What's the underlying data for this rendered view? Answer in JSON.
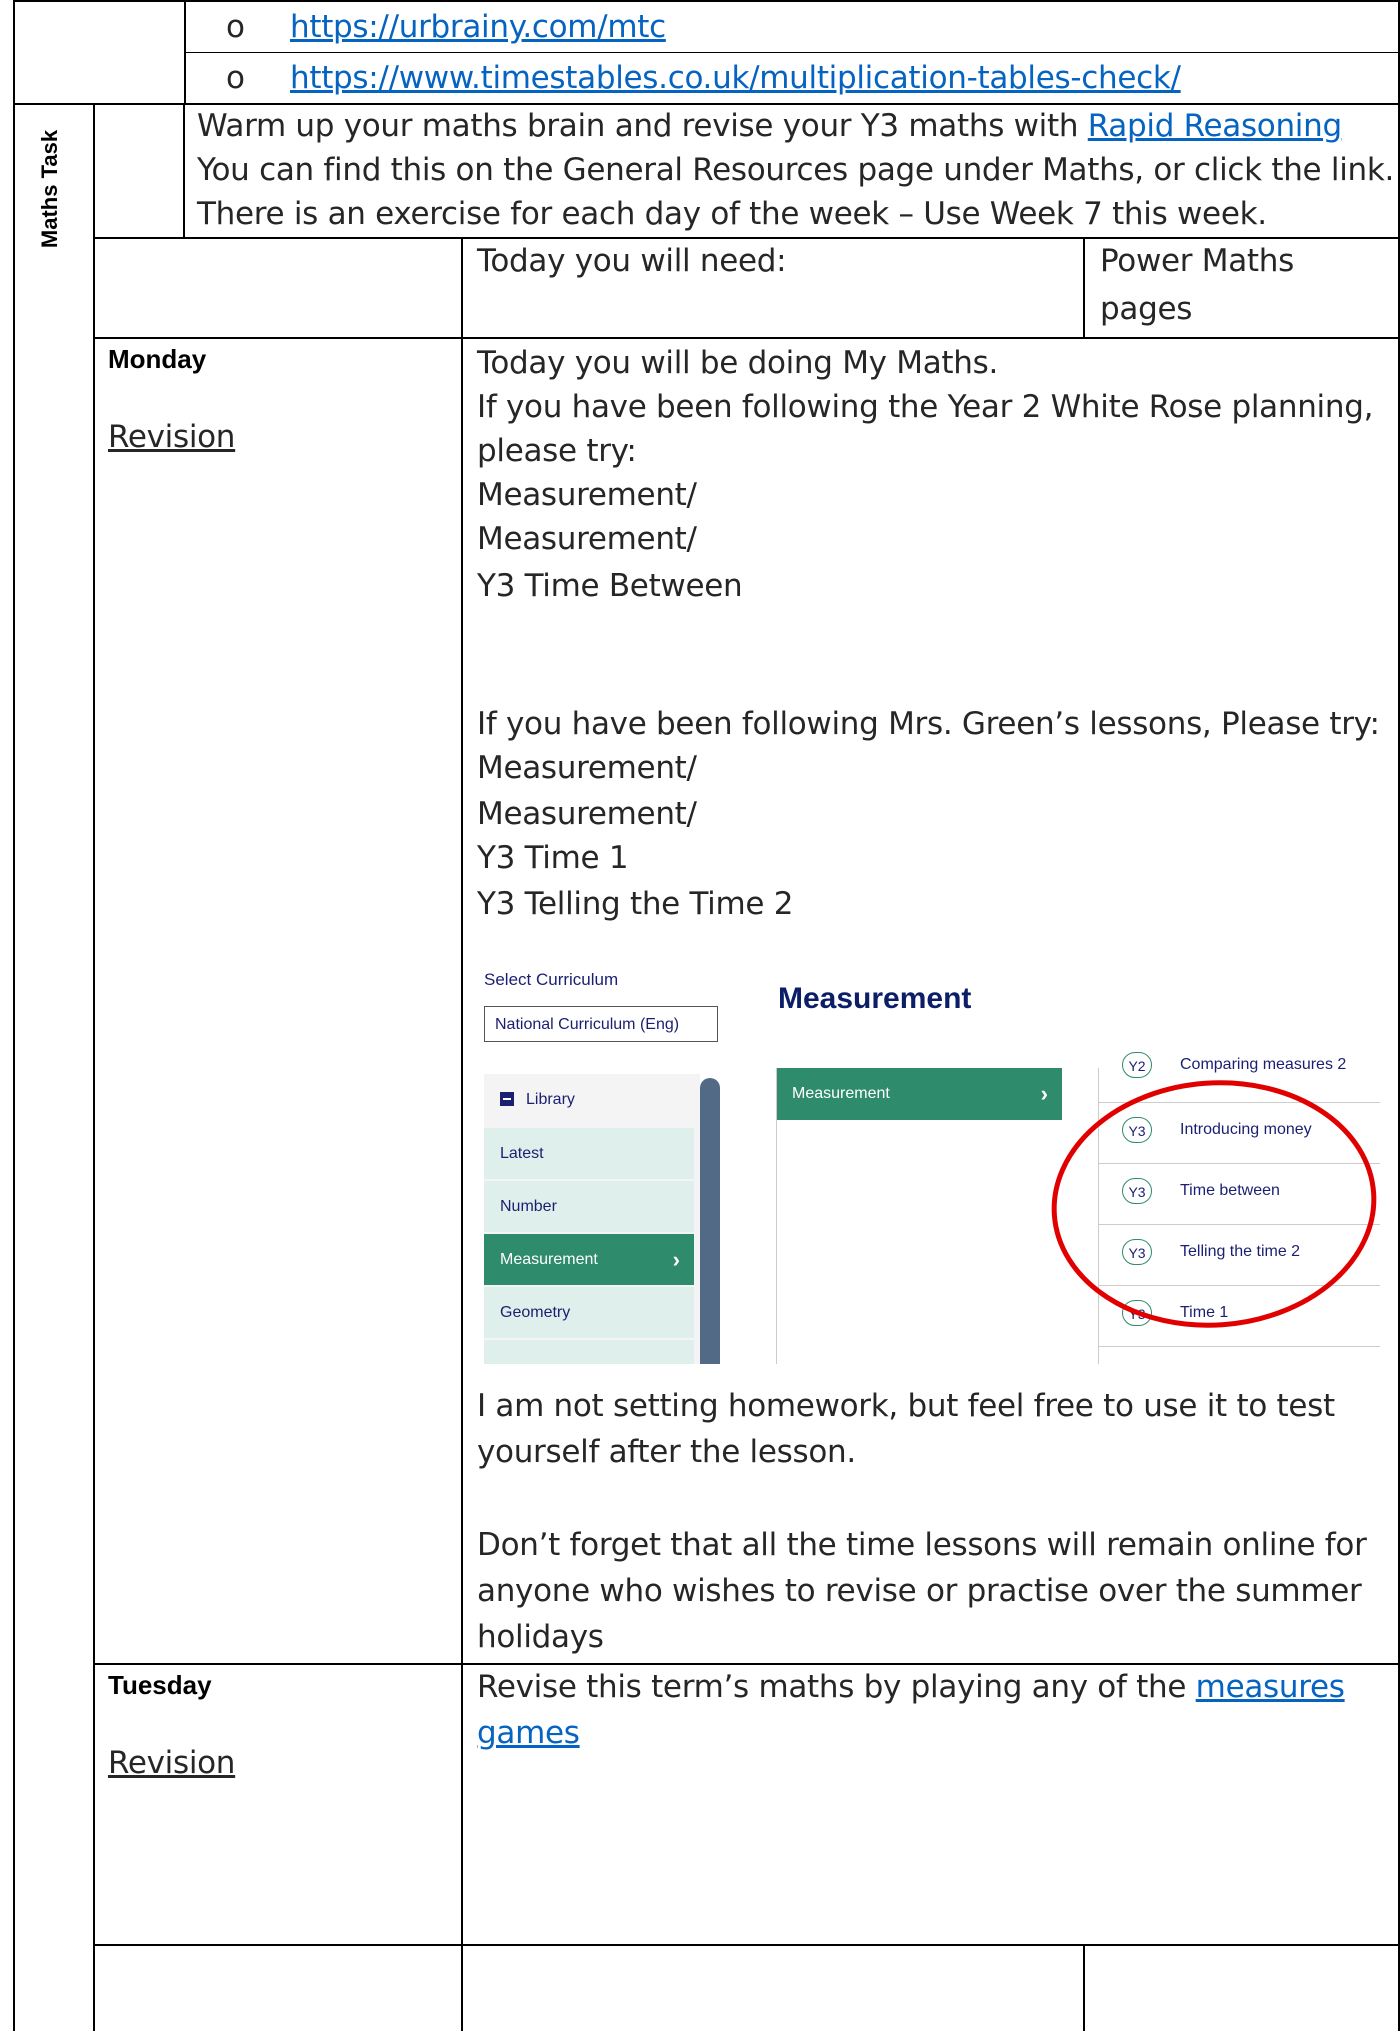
{
  "links_list": [
    {
      "bullet": "o",
      "text": "https://urbrainy.com/mtc"
    },
    {
      "bullet": "o",
      "text": "https://www.timestables.co.uk/multiplication-tables-check/"
    }
  ],
  "side_label": "Maths Task",
  "warmup": {
    "line1_prefix": "Warm up your maths brain and revise your Y3 maths with ",
    "line1_link": "Rapid Reasoning",
    "line2": "You can find this on the General Resources page under Maths, or click the link.",
    "line3": "There is an exercise for each day of the week – Use Week 7 this week."
  },
  "header_row": {
    "need_label": "Today you will need:",
    "pages_line1": "Power Maths",
    "pages_line2": "pages"
  },
  "monday": {
    "day": "Monday",
    "subtitle": "Revision",
    "lines_a": [
      "Today you will be doing My Maths.",
      "If you have been following the Year 2 White Rose planning,",
      "please try:",
      "Measurement/",
      "Measurement/",
      "Y3 Time Between"
    ],
    "lines_b": [
      "If you have been following Mrs. Green’s lessons, Please try:",
      "Measurement/",
      "Measurement/",
      "Y3 Time 1",
      "Y3 Telling the Time 2"
    ],
    "lines_c": [
      "I am not setting homework, but feel free to use it to test",
      "yourself after the lesson."
    ],
    "lines_d": [
      "Don’t forget that all the time lessons will remain online for",
      "anyone who wishes to revise or practise over the summer",
      "holidays"
    ]
  },
  "screenshot": {
    "select_label": "Select Curriculum",
    "select_value": "National Curriculum (Eng)",
    "title": "Measurement",
    "library_label": "Library",
    "menu": [
      "Latest",
      "Number",
      "Measurement",
      "Geometry"
    ],
    "active_menu": "Measurement",
    "category": "Measurement",
    "topics": [
      {
        "year": "Y2",
        "name": "Comparing measures 2"
      },
      {
        "year": "Y3",
        "name": "Introducing money"
      },
      {
        "year": "Y3",
        "name": "Time between"
      },
      {
        "year": "Y3",
        "name": "Telling the time 2"
      },
      {
        "year": "Y3",
        "name": "Time 1"
      }
    ],
    "highlight_color": "#e00000",
    "accent_color": "#2e8b6b"
  },
  "tuesday": {
    "day": "Tuesday",
    "subtitle": "Revision",
    "line1_prefix": "Revise this term’s maths by playing any of the ",
    "line1_link": "measures",
    "line2_link": "games"
  }
}
